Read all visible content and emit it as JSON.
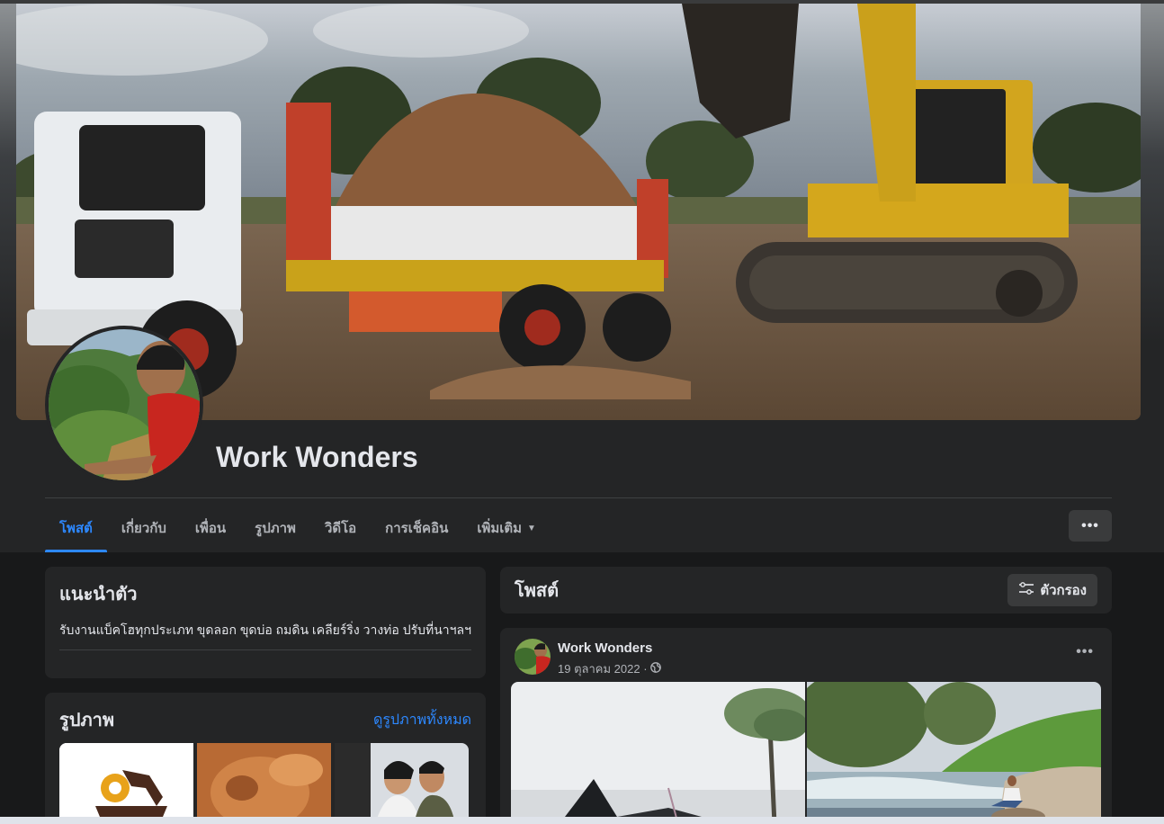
{
  "profile": {
    "name": "Work Wonders"
  },
  "tabs": [
    {
      "label": "โพสต์"
    },
    {
      "label": "เกี่ยวกับ"
    },
    {
      "label": "เพื่อน"
    },
    {
      "label": "รูปภาพ"
    },
    {
      "label": "วิดีโอ"
    },
    {
      "label": "การเช็คอิน"
    },
    {
      "label": "เพิ่มเติม"
    }
  ],
  "header": {
    "more_button_label": "•••",
    "tab_more_caret": "▼"
  },
  "intro": {
    "title": "แนะนำตัว",
    "bio": "รับงานแบ็คโฮทุกประเภท ขุดลอก ขุดบ่อ ถมดิน เคลียร์ริ่ง วางท่อ ปรับที่นาฯลฯ"
  },
  "photos": {
    "title": "รูปภาพ",
    "see_all": "ดูรูปภาพทั้งหมด"
  },
  "posts": {
    "title": "โพสต์",
    "filter_label": "ตัวกรอง",
    "filter_icon": "sliders-icon"
  },
  "post": {
    "author": "Work Wonders",
    "date": "19 ตุลาคม 2022 ·",
    "privacy_icon": "globe-icon",
    "menu_label": "•••"
  },
  "colors": {
    "accent": "#2d88ff",
    "background": "#18191a",
    "card": "#242526",
    "button": "#3a3b3c"
  }
}
